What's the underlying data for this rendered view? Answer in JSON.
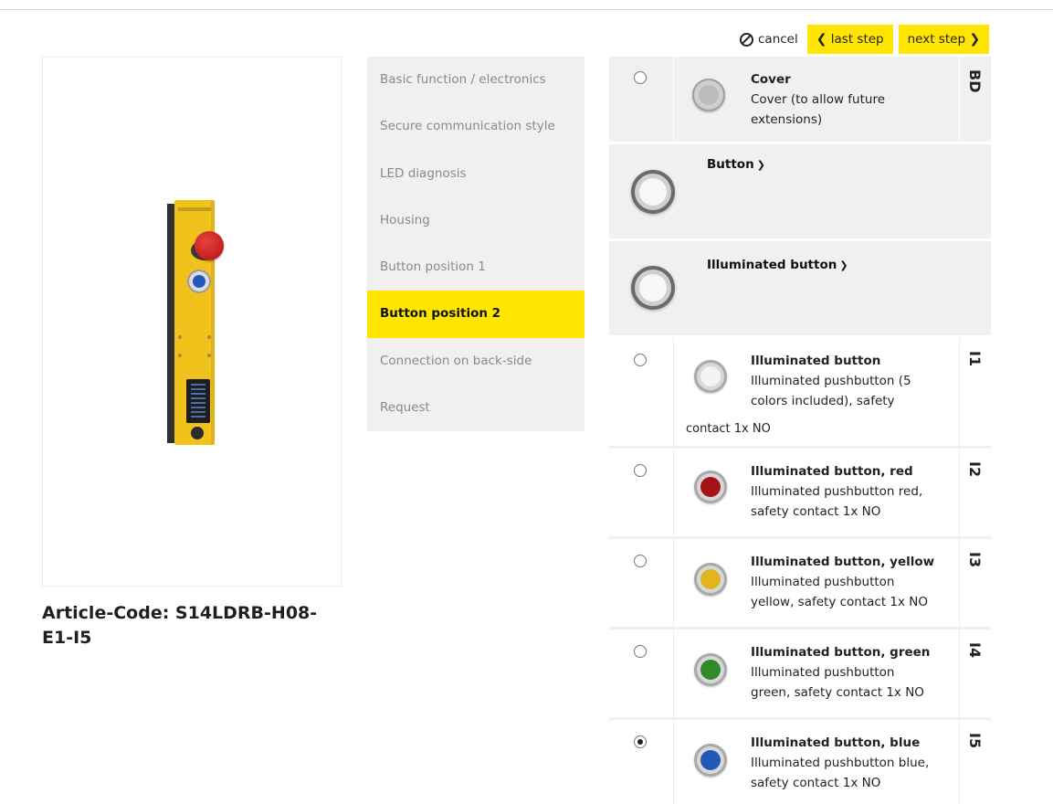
{
  "header": {
    "cancel_label": "cancel",
    "last_step_label": "last step",
    "next_step_label": "next step"
  },
  "product": {
    "article_code": "Article-Code: S14LDRB-H08-E1-I5",
    "housing_color": "#f1c21b"
  },
  "steps": [
    {
      "label": "Basic function / electronics",
      "active": false
    },
    {
      "label": "Secure communication style",
      "active": false
    },
    {
      "label": "LED diagnosis",
      "active": false
    },
    {
      "label": "Housing",
      "active": false
    },
    {
      "label": "Button position 1",
      "active": false
    },
    {
      "label": "Button position 2",
      "active": true
    },
    {
      "label": "Connection on back-side",
      "active": false
    },
    {
      "label": "Request",
      "active": false
    }
  ],
  "options": {
    "cover": {
      "title": "Cover",
      "description": "Cover (to allow future extensions)",
      "code": "BD",
      "selected": false
    },
    "groups": [
      {
        "label": "Button",
        "icon": "chevron-down-icon"
      },
      {
        "label": "Illuminated button",
        "icon": "chevron-down-icon"
      }
    ],
    "items": [
      {
        "title": "Illuminated button",
        "desc_line1": "Illuminated pushbutton (5",
        "desc_line2": "colors included), safety",
        "desc_tail": "contact 1x NO",
        "code": "I1",
        "color": "#f4f4f4",
        "selected": false
      },
      {
        "title": "Illuminated button, red",
        "desc_line1": "Illuminated pushbutton red,",
        "desc_line2": "safety contact 1x NO",
        "code": "I2",
        "color": "#a51218",
        "selected": false
      },
      {
        "title": "Illuminated button, yellow",
        "desc_line1": "Illuminated pushbutton",
        "desc_line2": "yellow, safety contact 1x NO",
        "code": "I3",
        "color": "#e3b51c",
        "selected": false
      },
      {
        "title": "Illuminated button, green",
        "desc_line1": "Illuminated pushbutton",
        "desc_line2": "green, safety contact 1x NO",
        "code": "I4",
        "color": "#2f8a2a",
        "selected": false
      },
      {
        "title": "Illuminated button, blue",
        "desc_line1": "Illuminated pushbutton blue,",
        "desc_line2": "safety contact 1x NO",
        "code": "I5",
        "color": "#2557b7",
        "selected": true
      }
    ]
  },
  "colors": {
    "accent": "#ffe500",
    "panel": "#f0f0f0"
  }
}
